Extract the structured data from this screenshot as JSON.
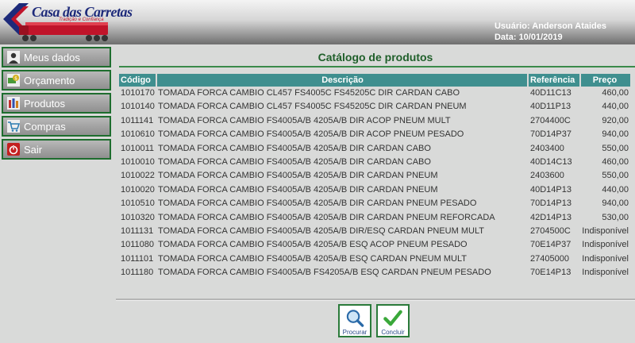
{
  "header": {
    "logo_title": "Casa das Carretas",
    "logo_tagline": "Tradição e Confiança",
    "user_label": "Usuário:",
    "user_name": "Anderson Ataides",
    "date_label": "Data:",
    "date_value": "10/01/2019"
  },
  "sidebar": {
    "items": [
      {
        "label": "Meus dados",
        "icon": "person-icon"
      },
      {
        "label": "Orçamento",
        "icon": "money-icon"
      },
      {
        "label": "Produtos",
        "icon": "products-icon"
      },
      {
        "label": "Compras",
        "icon": "cart-icon"
      },
      {
        "label": "Sair",
        "icon": "power-icon"
      }
    ]
  },
  "main": {
    "title": "Catálogo de produtos",
    "columns": [
      "Código",
      "Descrição",
      "Referência",
      "Preço"
    ],
    "rows": [
      [
        "1010170",
        "TOMADA FORCA CAMBIO CL457 FS4005C FS45205C DIR CARDAN CABO",
        "40D11C13",
        "460,00"
      ],
      [
        "1010140",
        "TOMADA FORCA CAMBIO CL457 FS4005C FS45205C DIR CARDAN PNEUM",
        "40D11P13",
        "440,00"
      ],
      [
        "1011141",
        "TOMADA FORCA CAMBIO FS4005A/B 4205A/B DIR ACOP PNEUM MULT",
        "2704400C",
        "920,00"
      ],
      [
        "1010610",
        "TOMADA FORCA CAMBIO FS4005A/B 4205A/B DIR ACOP PNEUM PESADO",
        "70D14P37",
        "940,00"
      ],
      [
        "1010011",
        "TOMADA FORCA CAMBIO FS4005A/B 4205A/B DIR CARDAN CABO",
        "2403400",
        "550,00"
      ],
      [
        "1010010",
        "TOMADA FORCA CAMBIO FS4005A/B 4205A/B DIR CARDAN CABO",
        "40D14C13",
        "460,00"
      ],
      [
        "1010022",
        "TOMADA FORCA CAMBIO FS4005A/B 4205A/B DIR CARDAN PNEUM",
        "2403600",
        "550,00"
      ],
      [
        "1010020",
        "TOMADA FORCA CAMBIO FS4005A/B 4205A/B DIR CARDAN PNEUM",
        "40D14P13",
        "440,00"
      ],
      [
        "1010510",
        "TOMADA FORCA CAMBIO FS4005A/B 4205A/B DIR CARDAN PNEUM PESADO",
        "70D14P13",
        "940,00"
      ],
      [
        "1010320",
        "TOMADA FORCA CAMBIO FS4005A/B 4205A/B DIR CARDAN PNEUM REFORCADA",
        "42D14P13",
        "530,00"
      ],
      [
        "1011131",
        "TOMADA FORCA CAMBIO FS4005A/B 4205A/B DIR/ESQ CARDAN PNEUM MULT",
        "2704500C",
        "Indisponível"
      ],
      [
        "1011080",
        "TOMADA FORCA CAMBIO FS4005A/B 4205A/B ESQ ACOP PNEUM PESADO",
        "70E14P37",
        "Indisponível"
      ],
      [
        "1011101",
        "TOMADA FORCA CAMBIO FS4005A/B 4205A/B ESQ CARDAN PNEUM MULT",
        "27405000",
        "Indisponível"
      ],
      [
        "1011180",
        "TOMADA FORCA CAMBIO FS4005A/B FS4205A/B ESQ CARDAN PNEUM PESADO",
        "70E14P13",
        "Indisponível"
      ]
    ],
    "actions": {
      "search_label": "Procurar",
      "finish_label": "Concluir"
    }
  },
  "colors": {
    "accent_green": "#1e6d2e",
    "header_teal": "#3f8f8f",
    "logo_blue": "#1d2a7a",
    "logo_red": "#c0142a"
  }
}
